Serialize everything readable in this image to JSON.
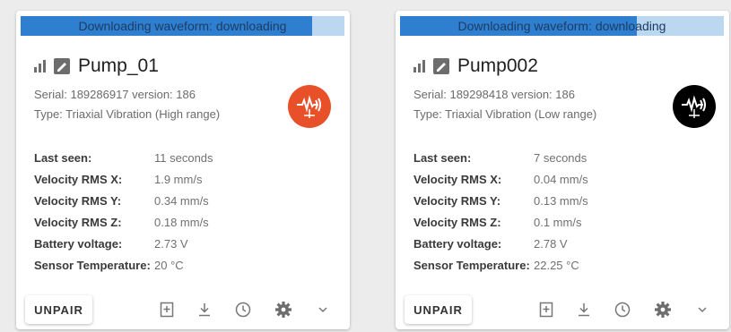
{
  "cards": [
    {
      "progress": {
        "text": "Downloading waveform: downloading",
        "fraction": 0.9
      },
      "name": "Pump_01",
      "serial_line": "Serial: 189286917 version: 186",
      "type_line": "Type: Triaxial Vibration (High range)",
      "badge_color": "#e8502a",
      "stats": [
        {
          "label": "Last seen:",
          "value": "11 seconds"
        },
        {
          "label": "Velocity RMS X:",
          "value": "1.9 mm/s"
        },
        {
          "label": "Velocity RMS Y:",
          "value": "0.34 mm/s"
        },
        {
          "label": "Velocity RMS Z:",
          "value": "0.18 mm/s"
        },
        {
          "label": "Battery voltage:",
          "value": "2.73 V"
        },
        {
          "label": "Sensor Temperature:",
          "value": "20 °C"
        }
      ],
      "button": "UNPAIR"
    },
    {
      "progress": {
        "text": "Downloading waveform: downloading",
        "fraction": 0.73
      },
      "name": "Pump002",
      "serial_line": "Serial: 189298418 version: 186",
      "type_line": "Type: Triaxial Vibration (Low range)",
      "badge_color": "#000000",
      "stats": [
        {
          "label": "Last seen:",
          "value": "7 seconds"
        },
        {
          "label": "Velocity RMS X:",
          "value": "0.04 mm/s"
        },
        {
          "label": "Velocity RMS Y:",
          "value": "0.13 mm/s"
        },
        {
          "label": "Velocity RMS Z:",
          "value": "0.1 mm/s"
        },
        {
          "label": "Battery voltage:",
          "value": "2.78 V"
        },
        {
          "label": "Sensor Temperature:",
          "value": "22.25 °C"
        }
      ],
      "button": "UNPAIR"
    }
  ],
  "icons": [
    "signal-bars-icon",
    "sensor-tag-icon",
    "vibration-sensor-icon",
    "add-bookmark-icon",
    "download-icon",
    "history-clock-icon",
    "settings-gear-icon",
    "chevron-down-icon"
  ],
  "colors": {
    "progress_fill": "#2f7fd0",
    "progress_track": "#bcd7f0"
  }
}
